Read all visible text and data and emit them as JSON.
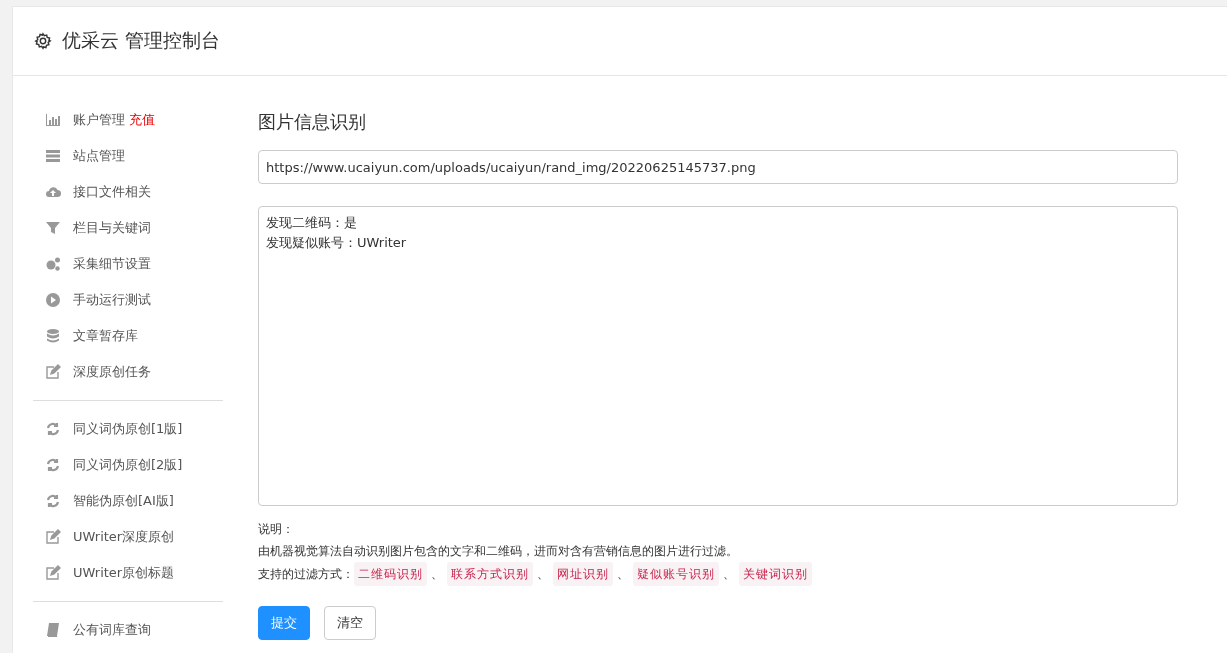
{
  "header": {
    "title": "优采云 管理控制台"
  },
  "sidebar": {
    "groups": [
      [
        {
          "label": "账户管理",
          "badge": "充值"
        },
        {
          "label": "站点管理"
        },
        {
          "label": "接口文件相关"
        },
        {
          "label": "栏目与关键词"
        },
        {
          "label": "采集细节设置"
        },
        {
          "label": "手动运行测试"
        },
        {
          "label": "文章暂存库"
        },
        {
          "label": "深度原创任务"
        }
      ],
      [
        {
          "label": "同义词伪原创[1版]"
        },
        {
          "label": "同义词伪原创[2版]"
        },
        {
          "label": "智能伪原创[AI版]"
        },
        {
          "label": "UWriter深度原创"
        },
        {
          "label": "UWriter原创标题"
        }
      ],
      [
        {
          "label": "公有词库查询"
        }
      ]
    ]
  },
  "main": {
    "title": "图片信息识别",
    "url_field": {
      "value": "https://www.ucaiyun.com/uploads/ucaiyun/rand_img/20220625145737.png"
    },
    "result_area": {
      "lines": [
        "发现二维码：是",
        "发现疑似账号：UWriter"
      ]
    },
    "notes": {
      "heading": "说明：",
      "description": "由机器视觉算法自动识别图片包含的文字和二维码，进而对含有营销信息的图片进行过滤。",
      "methods_label": "支持的过滤方式：",
      "separator": "、",
      "methods": [
        "二维码识别",
        "联系方式识别",
        "网址识别",
        "疑似账号识别",
        "关键词识别"
      ]
    },
    "buttons": [
      {
        "label": "提交",
        "kind": "primary"
      },
      {
        "label": "清空",
        "kind": "default"
      }
    ]
  }
}
